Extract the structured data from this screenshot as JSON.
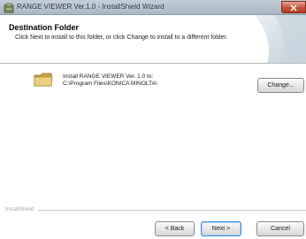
{
  "window": {
    "title": "RANGE VIEWER Ver.1.0 - InstallShield Wizard"
  },
  "header": {
    "title": "Destination Folder",
    "subtitle": "Click Next to install to this folder, or click Change to install to a different folder."
  },
  "destination": {
    "line1": "Install RANGE VIEWER Ver. 1.0 to:",
    "path": "C:\\Program Files\\KONICA MINOLTA\\"
  },
  "buttons": {
    "change": "Change...",
    "back": "< Back",
    "next": "Next >",
    "cancel": "Cancel"
  },
  "footer": {
    "brand": "InstallShield"
  },
  "colors": {
    "titlebar": "#b1bfcb",
    "close_button": "#c8503a",
    "folder": "#e4c56a",
    "default_button_border": "#3b8ed8"
  },
  "icons": [
    "installer-app-icon",
    "close-icon",
    "folder-icon",
    "banner-graphic"
  ]
}
